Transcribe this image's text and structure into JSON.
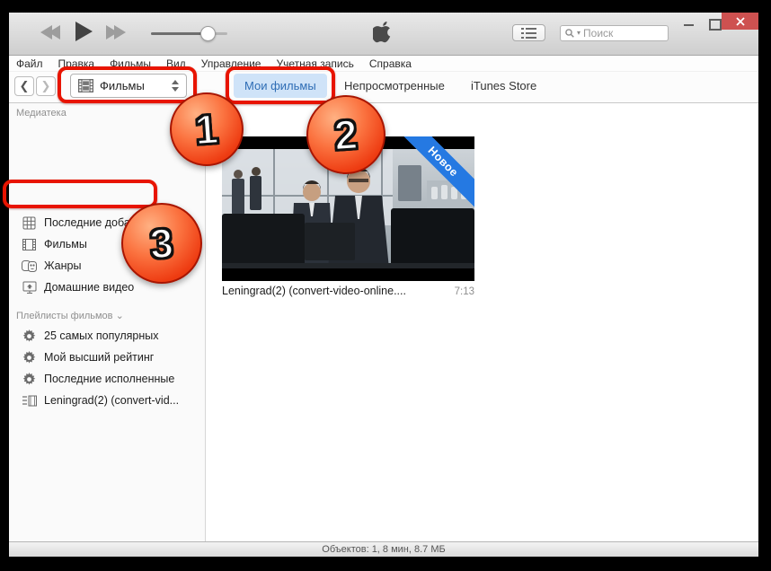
{
  "colors": {
    "accent_blue": "#2e6db5",
    "tab_active_bg": "#cfe3f8",
    "ribbon_blue": "#2579e2",
    "annotation_red": "#e81400",
    "close_button_red": "#ce5150"
  },
  "toolbar": {
    "search_placeholder": "Поиск"
  },
  "menubar": {
    "items": [
      "Файл",
      "Правка",
      "Фильмы",
      "Вид",
      "Управление",
      "Учетная запись",
      "Справка"
    ]
  },
  "nav": {
    "media_picker_label": "Фильмы",
    "tabs": [
      {
        "label": "Мои фильмы"
      },
      {
        "label": "Непросмотренные"
      },
      {
        "label": "iTunes Store"
      }
    ]
  },
  "sidebar": {
    "library_header": "Медиатека",
    "library_items": [
      {
        "label": "Последние добавленные"
      },
      {
        "label": "Фильмы"
      },
      {
        "label": "Жанры"
      },
      {
        "label": "Домашние видео"
      }
    ],
    "playlists_header": "Плейлисты фильмов",
    "playlist_items": [
      {
        "label": "25 самых популярных"
      },
      {
        "label": "Мой высший рейтинг"
      },
      {
        "label": "Последние исполненные"
      },
      {
        "label": "Leningrad(2)  (convert-vid..."
      }
    ]
  },
  "content": {
    "video": {
      "badge": "Новое",
      "title": "Leningrad(2)  (convert-video-online....",
      "duration": "7:13"
    }
  },
  "statusbar": {
    "text": "Объектов: 1, 8 мин, 8.7 МБ"
  },
  "annotations": {
    "steps": [
      "1",
      "2",
      "3"
    ]
  }
}
